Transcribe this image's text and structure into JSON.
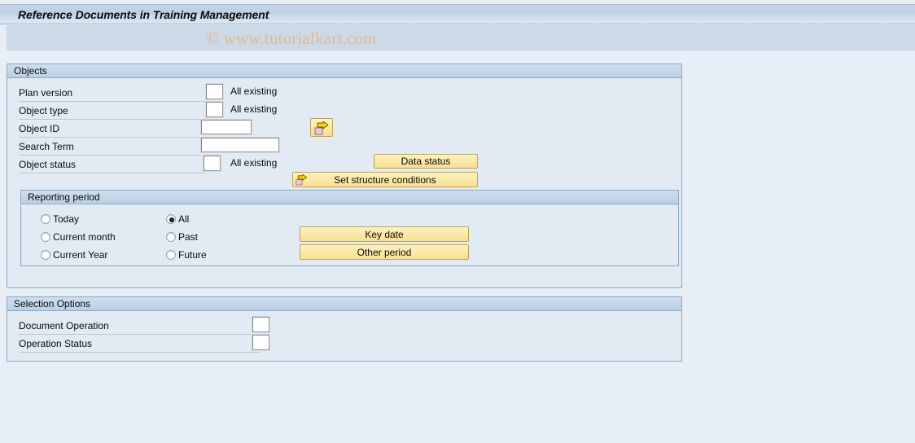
{
  "window": {
    "title": "Reference Documents in Training Management"
  },
  "watermark": {
    "text": "© www.tutorialkart.com"
  },
  "objects": {
    "title": "Objects",
    "rows": [
      {
        "label": "Plan version",
        "value": "",
        "suffix": "All existing",
        "field": "tiny"
      },
      {
        "label": "Object type",
        "value": "",
        "suffix": "All existing",
        "field": "tiny"
      },
      {
        "label": "Object ID",
        "value": "",
        "suffix": "",
        "field": "small"
      },
      {
        "label": "Search Term",
        "value": "",
        "suffix": "",
        "field": "med"
      },
      {
        "label": "Object status",
        "value": "",
        "suffix": "All existing",
        "field": "tiny"
      }
    ],
    "object_id_picker_icon": "arrow-right-icon",
    "data_status_button": "Data status",
    "set_structure_conditions_button": "Set structure conditions",
    "set_structure_conditions_icon": "arrow-right-icon"
  },
  "reporting_period": {
    "title": "Reporting period",
    "selected": "All",
    "left_options": [
      {
        "label": "Today",
        "selected": false
      },
      {
        "label": "Current month",
        "selected": false
      },
      {
        "label": "Current Year",
        "selected": false
      }
    ],
    "right_options": [
      {
        "label": "All",
        "selected": true
      },
      {
        "label": "Past",
        "selected": false
      },
      {
        "label": "Future",
        "selected": false
      }
    ],
    "key_date_button": "Key date",
    "other_period_button": "Other period"
  },
  "selection_options": {
    "title": "Selection Options",
    "rows": [
      {
        "label": "Document Operation",
        "value": ""
      },
      {
        "label": "Operation Status",
        "value": ""
      }
    ]
  },
  "colors": {
    "page_background": "#e8eef6",
    "panel_background": "#e2ebf4",
    "panel_border": "#8aa9c6",
    "titlebar_gradient_top": "#c3d4e6",
    "button_yellow": "#fbe9a4",
    "watermark": "#e9b88c"
  }
}
